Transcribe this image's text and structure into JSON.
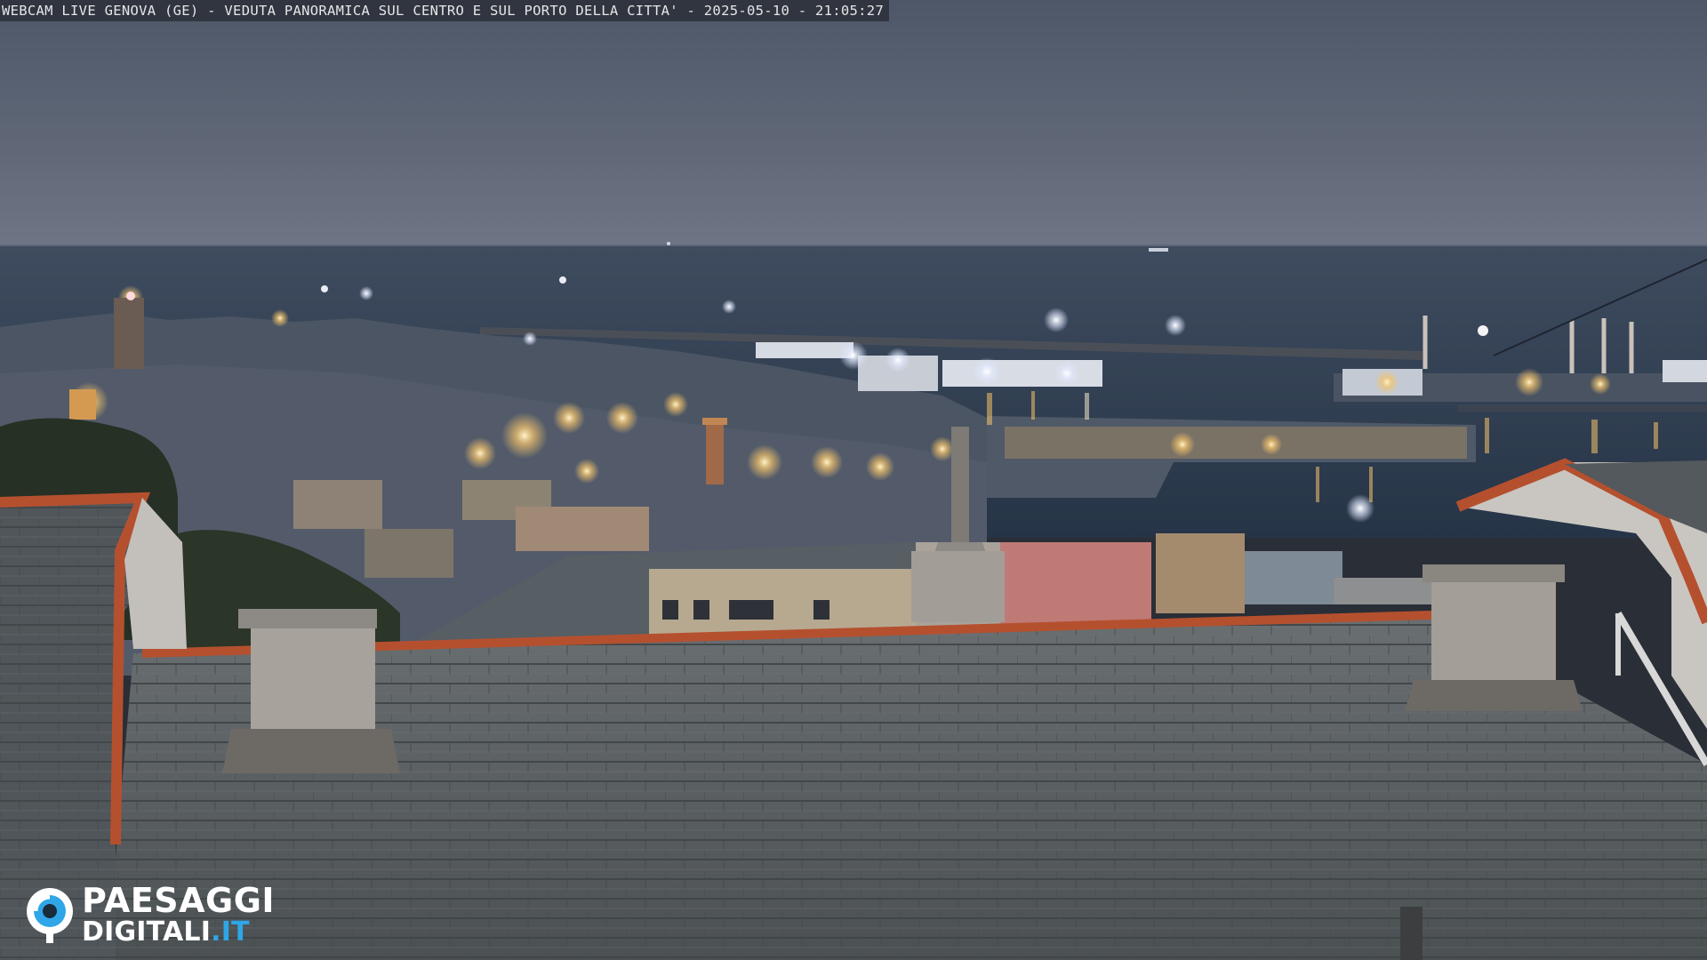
{
  "overlay": {
    "caption": "WEBCAM LIVE GENOVA (GE) - VEDUTA PANORAMICA SUL CENTRO E SUL PORTO DELLA CITTA' - 2025-05-10 - 21:05:27"
  },
  "logo": {
    "line1": "PAESAGGI",
    "line2_main": "DIGITALI",
    "line2_accent": ".IT",
    "accent_color": "#2fa6e8",
    "icon": "webcam-eye-icon"
  },
  "colors": {
    "sky_top": "#535c6c",
    "sky_horizon": "#6d7585",
    "sea": "#2e3b4f",
    "roof": "#5d6265",
    "roof_edge": "#b5502f",
    "city_lights": "#f4c36a"
  }
}
